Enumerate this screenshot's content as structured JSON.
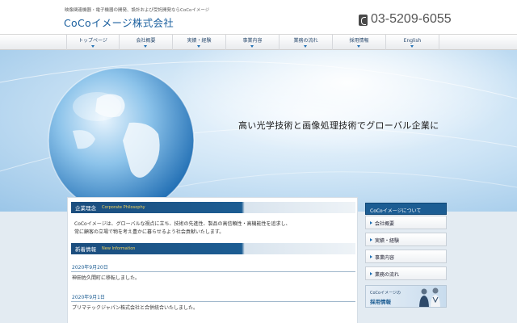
{
  "header": {
    "tagline": "映像関連機器・電子機器の開発、設計および受託開発ならCoCoイメージ",
    "logo": "CoCoイメージ株式会社",
    "phone": "03-5209-6055"
  },
  "nav": {
    "items": [
      {
        "label": "トップページ"
      },
      {
        "label": "会社概要"
      },
      {
        "label": "実績・経験"
      },
      {
        "label": "事業内容"
      },
      {
        "label": "業務の流れ"
      },
      {
        "label": "採用情報"
      },
      {
        "label": "English"
      }
    ]
  },
  "hero": {
    "headline": "高い光学技術と画像処理技術でグローバル企業に"
  },
  "philosophy": {
    "title": "企業理念",
    "subtitle": "Corporate Philosophy",
    "text_line1": "CoCoイメージは、グローバルな視点に立ち、技術の先進性、製品の高信頼性・高機能性を追求し、",
    "text_line2": "常に顧客の立場で物を考え豊かに暮らせるよう社会貢献いたします。"
  },
  "news": {
    "title": "新着情報",
    "subtitle": "New Information",
    "items": [
      {
        "date": "2020年9月20日",
        "text": "神田佐久間町に移転しました。"
      },
      {
        "date": "2020年9月1日",
        "text": "プリマテックジャパン株式会社と合併統合いたしました。"
      }
    ]
  },
  "sidebar": {
    "title": "CoCoイメージについて",
    "items": [
      {
        "label": "会社概要"
      },
      {
        "label": "実績・経験"
      },
      {
        "label": "事業内容"
      },
      {
        "label": "業務の流れ"
      }
    ],
    "recruit_line1": "CoCoイメージの",
    "recruit_line2": "採用情報"
  },
  "colors": {
    "brand": "#1a5f9e",
    "nav_text": "#2a4a6e",
    "section_header": "#1c4e7e",
    "accent_yellow": "#f5d65c",
    "content_bg": "#e3ebf2"
  },
  "icons": {
    "phone": "phone-icon",
    "nav_arrow": "chevron-down-icon",
    "side_bullet": "triangle-right-icon",
    "hero_image": "globe-image"
  }
}
